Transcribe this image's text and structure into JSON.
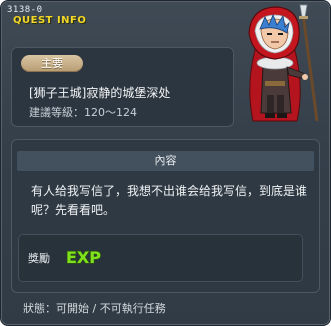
{
  "window": {
    "quest_id": "3138-0",
    "title": "QUEST INFO"
  },
  "main": {
    "badge_label": "主要",
    "quest_name": "[狮子王城]寂静的城堡深处",
    "level_text": "建議等級：120～124",
    "character_icon": "red-hooded-knight-portrait"
  },
  "content": {
    "header": "內容",
    "text": "有人给我写信了，我想不出谁会给我写信，到底是谁呢？先看看吧。"
  },
  "reward": {
    "label": "獎勵",
    "exp_icon": "exp-icon",
    "exp_text": "EXP"
  },
  "status": {
    "text": "狀態：可開始 / 不可執行任務"
  },
  "colors": {
    "title_yellow": "#f2d62a",
    "exp_green": "#7fe01e",
    "badge_tan": "#c8b089"
  }
}
